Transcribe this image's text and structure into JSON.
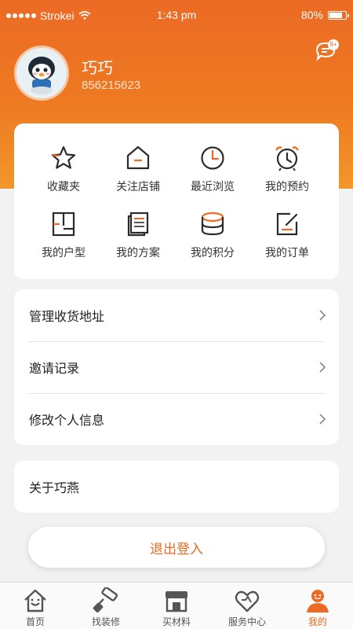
{
  "status_bar": {
    "carrier": "Strokei",
    "time": "1:43 pm",
    "battery": "80%"
  },
  "profile": {
    "name": "巧巧",
    "id": "856215623",
    "message_badge": "9+"
  },
  "grid": [
    {
      "label": "收藏夹",
      "icon": "star-icon"
    },
    {
      "label": "关注店铺",
      "icon": "shop-icon"
    },
    {
      "label": "最近浏览",
      "icon": "clock-icon"
    },
    {
      "label": "我的预约",
      "icon": "alarm-clock-icon"
    },
    {
      "label": "我的户型",
      "icon": "floor-plan-icon"
    },
    {
      "label": "我的方案",
      "icon": "document-icon"
    },
    {
      "label": "我的积分",
      "icon": "coins-icon"
    },
    {
      "label": "我的订单",
      "icon": "order-icon"
    }
  ],
  "menu": [
    {
      "label": "管理收货地址"
    },
    {
      "label": "邀请记录"
    },
    {
      "label": "修改个人信息"
    }
  ],
  "about": {
    "label": "关于巧燕"
  },
  "logout": {
    "label": "退出登入"
  },
  "tabs": [
    {
      "label": "首页",
      "icon": "home-icon"
    },
    {
      "label": "找装修",
      "icon": "paint-roller-icon"
    },
    {
      "label": "买材料",
      "icon": "store-icon"
    },
    {
      "label": "服务中心",
      "icon": "heart-service-icon"
    },
    {
      "label": "我的",
      "icon": "user-icon"
    }
  ],
  "colors": {
    "accent": "#ec6a24",
    "background": "#f2f2f2"
  }
}
